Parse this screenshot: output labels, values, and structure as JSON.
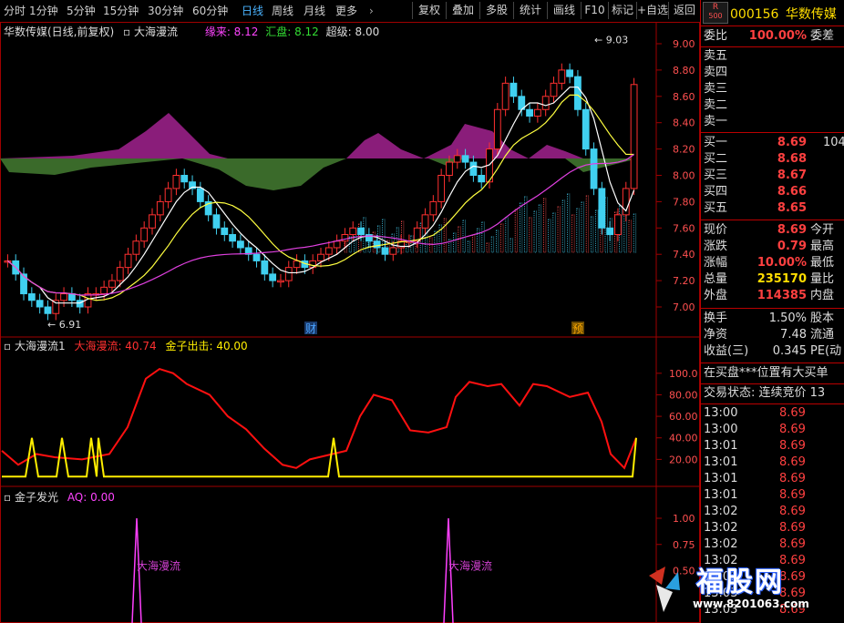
{
  "toolbar": {
    "periods": [
      "分时",
      "1分钟",
      "5分钟",
      "15分钟",
      "30分钟",
      "60分钟",
      "日线",
      "周线",
      "月线",
      "更多"
    ],
    "active_period": "日线",
    "more_arrow": "›",
    "buttons": [
      "复权",
      "叠加",
      "多股",
      "统计",
      "画线",
      "F10",
      "标记",
      "+自选",
      "返回"
    ]
  },
  "main_chart": {
    "title": "华数传媒(日线,前复权)",
    "indicator_name": "大海漫流",
    "items": [
      {
        "label": "缘来: 8.12",
        "color": "#ff44ff"
      },
      {
        "label": "汇盘: 8.12",
        "color": "#33dd33"
      },
      {
        "label": "超级: 8.00",
        "color": "#dddddd"
      }
    ],
    "y_ticks": [
      "9.00",
      "8.80",
      "8.60",
      "8.40",
      "8.20",
      "8.00",
      "7.80",
      "7.60",
      "7.40",
      "7.20",
      "7.00"
    ],
    "high_label": "9.03",
    "low_label": "6.91",
    "markers": [
      {
        "text": "财",
        "color": "#4aa3ff"
      },
      {
        "text": "预",
        "color": "#ffaa00"
      }
    ]
  },
  "sub1": {
    "name": "大海漫流1",
    "items": [
      {
        "label": "大海漫流: 40.74",
        "color": "#ff3030"
      },
      {
        "label": "金子出击: 40.00",
        "color": "#ffee00"
      }
    ],
    "y_ticks": [
      "100.0",
      "80.00",
      "60.00",
      "40.00",
      "20.00"
    ]
  },
  "sub2": {
    "name": "金子发光",
    "items": [
      {
        "label": "AQ: 0.00",
        "color": "#ff44ff"
      }
    ],
    "y_ticks": [
      "1.00",
      "0.75",
      "0.50"
    ],
    "spike_labels": [
      "大海漫流",
      "大海漫流"
    ]
  },
  "right_panel": {
    "badge_top": "R",
    "badge_bottom": "500",
    "code": "000156",
    "name": "华数传媒",
    "weibi": {
      "label": "委比",
      "value": "100.00%",
      "extra": "委差"
    },
    "asks": [
      {
        "label": "卖五",
        "price": "",
        "vol": ""
      },
      {
        "label": "卖四",
        "price": "",
        "vol": ""
      },
      {
        "label": "卖三",
        "price": "",
        "vol": ""
      },
      {
        "label": "卖二",
        "price": "",
        "vol": ""
      },
      {
        "label": "卖一",
        "price": "",
        "vol": ""
      }
    ],
    "bids": [
      {
        "label": "买一",
        "price": "8.69",
        "vol": "104"
      },
      {
        "label": "买二",
        "price": "8.68",
        "vol": ""
      },
      {
        "label": "买三",
        "price": "8.67",
        "vol": ""
      },
      {
        "label": "买四",
        "price": "8.66",
        "vol": ""
      },
      {
        "label": "买五",
        "price": "8.65",
        "vol": ""
      }
    ],
    "quotes": [
      {
        "label": "现价",
        "value": "8.69",
        "extra": "今开",
        "color": "#ff4040"
      },
      {
        "label": "涨跌",
        "value": "0.79",
        "extra": "最高",
        "color": "#ff4040"
      },
      {
        "label": "涨幅",
        "value": "10.00%",
        "extra": "最低",
        "color": "#ff4040"
      },
      {
        "label": "总量",
        "value": "235170",
        "extra": "量比",
        "color": "#ffdd00"
      },
      {
        "label": "外盘",
        "value": "114385",
        "extra": "内盘",
        "color": "#ff4040"
      }
    ],
    "fin": [
      {
        "label": "换手",
        "value": "1.50%",
        "extra": "股本"
      },
      {
        "label": "净资",
        "value": "7.48",
        "extra": "流通"
      },
      {
        "label": "收益(三)",
        "value": "0.345",
        "extra": "PE(动"
      }
    ],
    "notice1": "在买盘***位置有大买单",
    "notice2": "交易状态: 连续竞价 13",
    "ticks": [
      {
        "time": "13:00",
        "price": "8.69"
      },
      {
        "time": "13:00",
        "price": "8.69"
      },
      {
        "time": "13:01",
        "price": "8.69"
      },
      {
        "time": "13:01",
        "price": "8.69"
      },
      {
        "time": "13:01",
        "price": "8.69"
      },
      {
        "time": "13:01",
        "price": "8.69"
      },
      {
        "time": "13:02",
        "price": "8.69"
      },
      {
        "time": "13:02",
        "price": "8.69"
      },
      {
        "time": "13:02",
        "price": "8.69"
      },
      {
        "time": "13:02",
        "price": "8.69"
      },
      {
        "time": "13:03",
        "price": "8.69"
      },
      {
        "time": "13:03",
        "price": "8.69"
      },
      {
        "time": "13:03",
        "price": "8.69"
      }
    ]
  },
  "watermark": {
    "brand": "福股网",
    "url": "www.8201063.com"
  }
}
